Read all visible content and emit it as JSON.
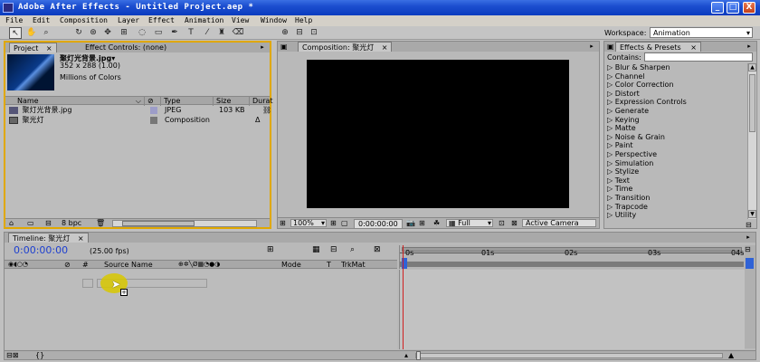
{
  "window": {
    "title": "Adobe After Effects - Untitled Project.aep *",
    "min": "_",
    "max": "□",
    "close": "X"
  },
  "menu": [
    "File",
    "Edit",
    "Composition",
    "Layer",
    "Effect",
    "Animation",
    "View",
    "Window",
    "Help"
  ],
  "toolbar": {
    "workspace_label": "Workspace:",
    "workspace_value": "Animation"
  },
  "project": {
    "tab_project": "Project",
    "tab_effect_controls": "Effect Controls: (none)",
    "thumb_name": "聚灯光背景.jpg▾",
    "thumb_dims": "352 x 288 (1.00)",
    "thumb_colors": "Millions of Colors",
    "col_name": "Name",
    "col_type": "Type",
    "col_size": "Size",
    "col_duration": "Durat",
    "items": [
      {
        "name": "聚灯光背景.jpg",
        "type": "JPEG",
        "size": "103 KB",
        "duration": ""
      },
      {
        "name": "聚光灯",
        "type": "Composition",
        "size": "",
        "duration": "Δ"
      }
    ],
    "bpc": "8 bpc"
  },
  "composition": {
    "tab": "Composition: 聚光灯",
    "zoom": "100%",
    "timecode": "0:00:00:00",
    "resolution": "Full",
    "camera": "Active Camera"
  },
  "effects": {
    "tab": "Effects & Presets",
    "contains_label": "Contains:",
    "categories": [
      "Blur & Sharpen",
      "Channel",
      "Color Correction",
      "Distort",
      "Expression Controls",
      "Generate",
      "Keying",
      "Matte",
      "Noise & Grain",
      "Paint",
      "Perspective",
      "Simulation",
      "Stylize",
      "Text",
      "Time",
      "Transition",
      "Trapcode",
      "Utility"
    ]
  },
  "timeline": {
    "tab": "Timeline: 聚光灯",
    "timecode": "0:00:00:00",
    "fps": "(25.00 fps)",
    "col_source": "Source Name",
    "col_mode": "Mode",
    "col_t": "T",
    "col_trkmat": "TrkMat",
    "col_hash": "#",
    "ruler": [
      "0s",
      "01s",
      "02s",
      "03s",
      "04s"
    ]
  },
  "colors": {
    "accent_title": "#1c4ecf",
    "panel": "#b9b9b9",
    "highlight_border": "#e0a800",
    "playhead": "#d02020",
    "cursor_highlight": "#d8c800"
  }
}
